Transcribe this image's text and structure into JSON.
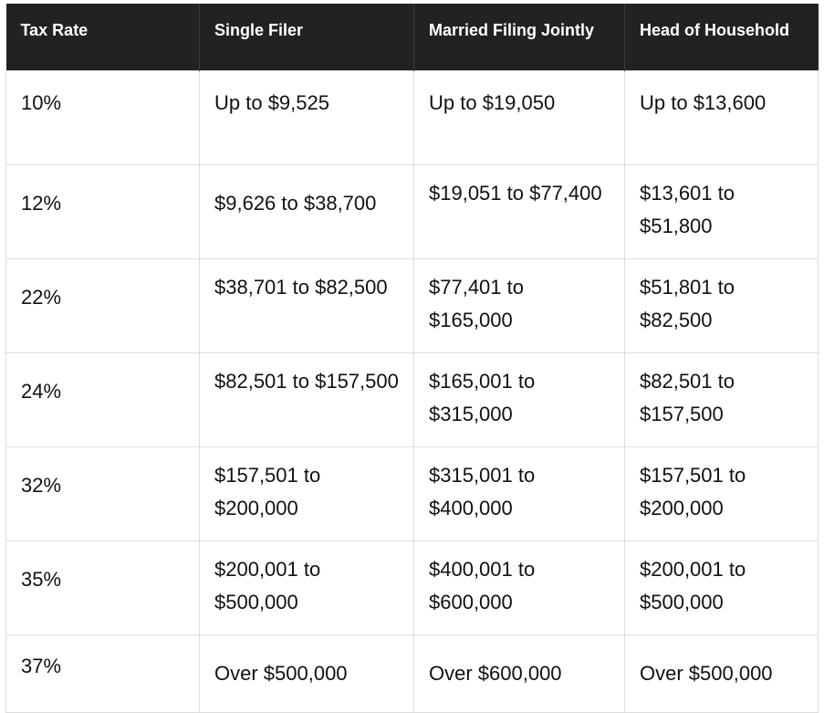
{
  "table": {
    "headers": [
      "Tax Rate",
      "Single Filer",
      "Married Filing Jointly",
      "Head of Household"
    ],
    "rows": [
      [
        "10%",
        "Up to $9,525",
        "Up to $19,050",
        "Up to $13,600"
      ],
      [
        "12%",
        "$9,626 to $38,700",
        "$19,051 to $77,400",
        "$13,601 to $51,800"
      ],
      [
        "22%",
        "$38,701 to $82,500",
        "$77,401 to $165,000",
        "$51,801 to $82,500"
      ],
      [
        "24%",
        "$82,501 to $157,500",
        "$165,001 to $315,000",
        "$82,501 to $157,500"
      ],
      [
        "32%",
        "$157,501 to $200,000",
        "$315,001 to $400,000",
        "$157,501 to $200,000"
      ],
      [
        "35%",
        "$200,001 to $500,000",
        "$400,001 to $600,000",
        "$200,001 to $500,000"
      ],
      [
        "37%",
        "Over $500,000",
        "Over $600,000",
        "Over $500,000"
      ]
    ]
  },
  "colors": {
    "header_bg": "#222222",
    "header_text": "#ffffff",
    "border": "#dddddd"
  }
}
